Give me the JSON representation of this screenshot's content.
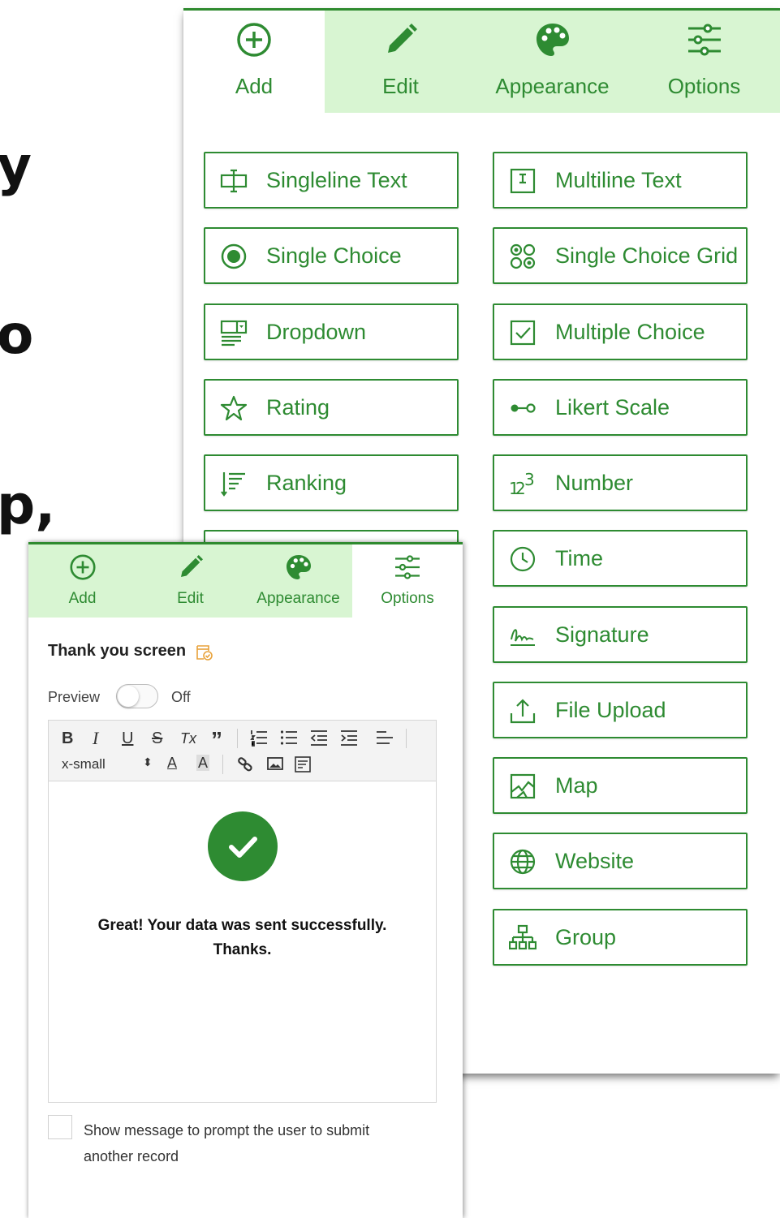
{
  "background_text": {
    "line1": "y",
    "line2": "o",
    "line3": "p,"
  },
  "back_panel": {
    "tabs": [
      {
        "label": "Add",
        "icon": "plus-circle-icon",
        "active": true
      },
      {
        "label": "Edit",
        "icon": "pencil-icon",
        "active": false
      },
      {
        "label": "Appearance",
        "icon": "palette-icon",
        "active": false
      },
      {
        "label": "Options",
        "icon": "sliders-icon",
        "active": false
      }
    ],
    "question_types": [
      {
        "label": "Singleline Text",
        "icon": "singleline-text-icon"
      },
      {
        "label": "Multiline Text",
        "icon": "multiline-text-icon"
      },
      {
        "label": "Single Choice",
        "icon": "radio-icon"
      },
      {
        "label": "Single Choice Grid",
        "icon": "choice-grid-icon"
      },
      {
        "label": "Dropdown",
        "icon": "dropdown-icon"
      },
      {
        "label": "Multiple Choice",
        "icon": "checkbox-icon"
      },
      {
        "label": "Rating",
        "icon": "star-icon"
      },
      {
        "label": "Likert Scale",
        "icon": "likert-icon"
      },
      {
        "label": "Ranking",
        "icon": "ranking-icon"
      },
      {
        "label": "Number",
        "icon": "number-icon"
      },
      {
        "label": "Time",
        "icon": "clock-icon"
      },
      {
        "label": "Signature",
        "icon": "signature-icon"
      },
      {
        "label": "File Upload",
        "icon": "upload-icon"
      },
      {
        "label": "Map",
        "icon": "map-icon"
      },
      {
        "label": "Website",
        "icon": "globe-icon"
      },
      {
        "label": "Group",
        "icon": "group-icon"
      }
    ]
  },
  "front_panel": {
    "tabs": [
      {
        "label": "Add",
        "icon": "plus-circle-icon",
        "active": false
      },
      {
        "label": "Edit",
        "icon": "pencil-icon",
        "active": false
      },
      {
        "label": "Appearance",
        "icon": "palette-icon",
        "active": false
      },
      {
        "label": "Options",
        "icon": "sliders-icon",
        "active": true
      }
    ],
    "section_title": "Thank you screen",
    "preview": {
      "label": "Preview",
      "state": "Off"
    },
    "toolbar": {
      "bold": "B",
      "italic": "I",
      "underline": "U",
      "strike": "S",
      "clear": "Tx",
      "quote": "”",
      "font_size": "x-small",
      "font_color": "A",
      "bg_color": "A"
    },
    "message_line1": "Great! Your data was sent successfully.",
    "message_line2": "Thanks.",
    "checkbox_label": "Show message to prompt the user to submit another record"
  },
  "colors": {
    "accent": "#2e8b32",
    "tab_bg": "#d8f5d2"
  }
}
